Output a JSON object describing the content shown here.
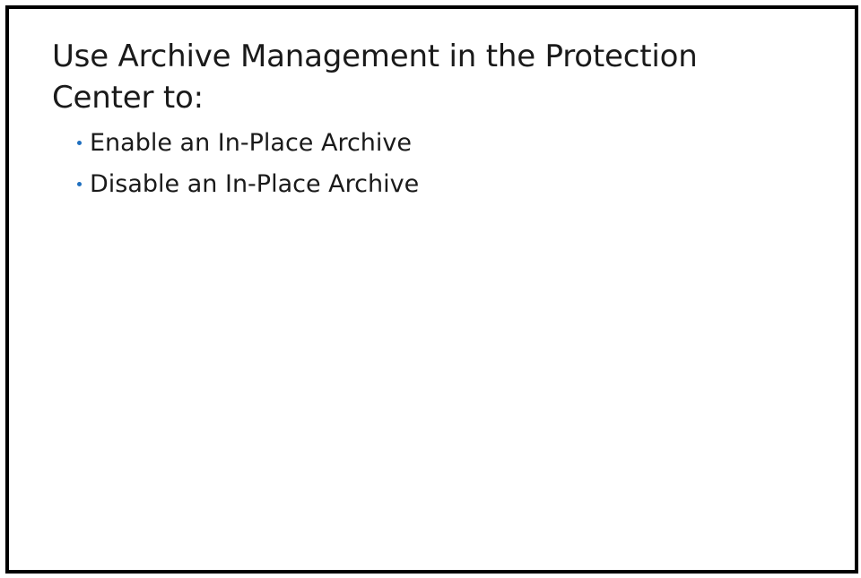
{
  "slide": {
    "heading": "Use Archive Management in the Protection Center to:",
    "bullets": [
      "Enable an In-Place Archive",
      "Disable an In-Place Archive"
    ],
    "bullet_color": "#1f6fbf",
    "border_color": "#000000"
  }
}
